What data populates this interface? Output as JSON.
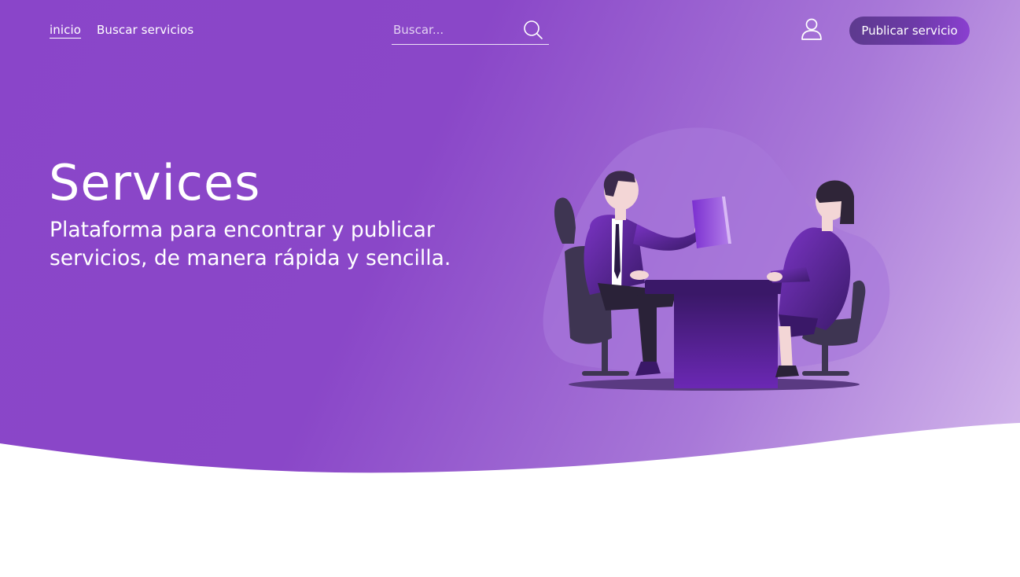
{
  "nav": {
    "home_label": "inicio",
    "search_services_label": "Buscar servicios"
  },
  "search": {
    "placeholder": "Buscar..."
  },
  "header": {
    "publish_button_label": "Publicar servicio",
    "user_icon": "user-icon",
    "search_icon": "search-icon"
  },
  "hero": {
    "title": "Services",
    "subtitle": "Plataforma para encontrar y publicar servicios, de manera rápida y sencilla."
  },
  "colors": {
    "primary": "#8a45c9",
    "accent_button": "#6d3aa8",
    "illustration_dark": "#3b1d63"
  }
}
